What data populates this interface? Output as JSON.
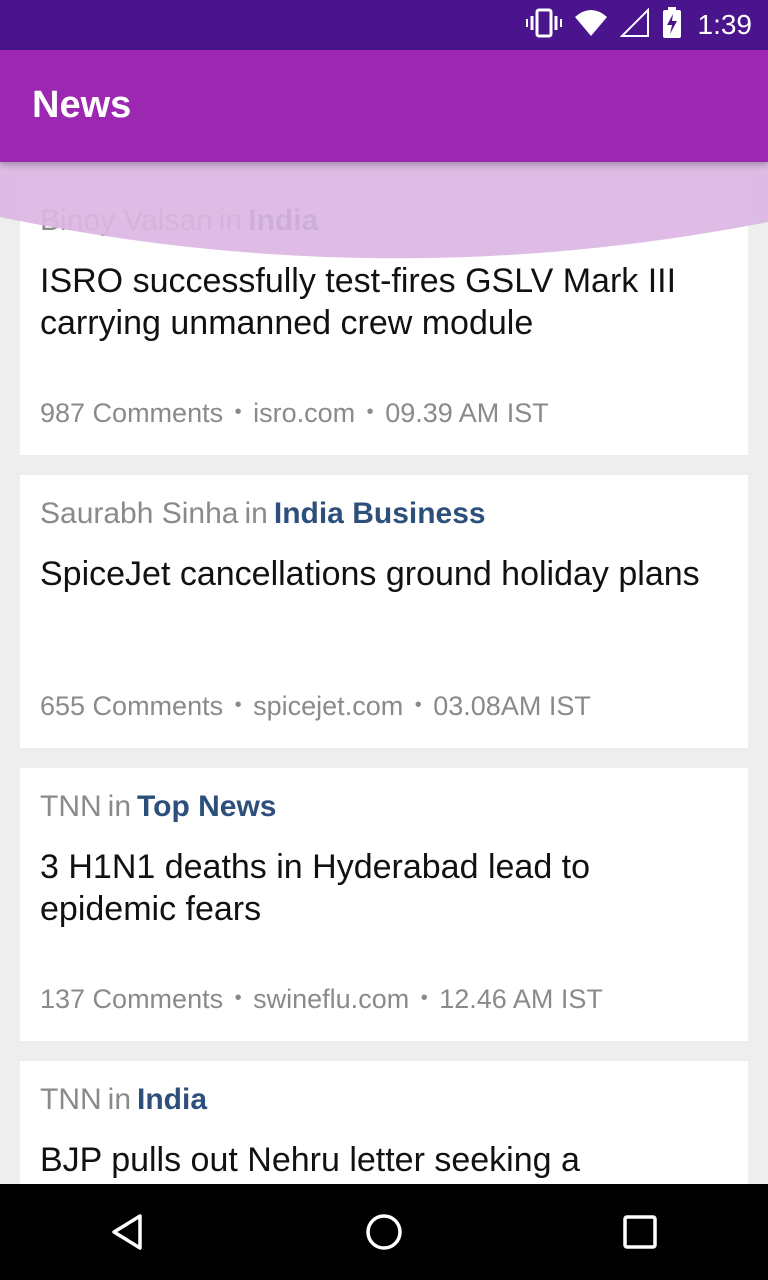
{
  "status_bar": {
    "time": "1:39",
    "icons": [
      "vibrate-icon",
      "wifi-icon",
      "signal-icon",
      "battery-charging-icon"
    ]
  },
  "app_bar": {
    "title": "News"
  },
  "colors": {
    "status_bar": "#4a148c",
    "app_bar": "#9c27b0",
    "section_link": "#2c4f7c",
    "ripple": "#dbb6e3"
  },
  "articles": [
    {
      "author": "Binoy Valsan",
      "in": "in",
      "section": "India",
      "headline": "ISRO successfully test-fires GSLV Mark III carrying unmanned crew module",
      "comments": "987 Comments",
      "source": "isro.com",
      "time": "09.39 AM IST"
    },
    {
      "author": "Saurabh Sinha",
      "in": "in",
      "section": "India Business",
      "headline": "SpiceJet cancellations ground holiday plans",
      "comments": "655 Comments",
      "source": "spicejet.com",
      "time": "03.08AM IST"
    },
    {
      "author": "TNN",
      "in": "in",
      "section": "Top News",
      "headline": "3 H1N1 deaths in Hyderabad lead to epidemic fears",
      "comments": "137 Comments",
      "source": "swineflu.com",
      "time": "12.46 AM IST"
    },
    {
      "author": "TNN",
      "in": "in",
      "section": "India",
      "headline": "BJP pulls out Nehru letter seeking a",
      "comments": "",
      "source": "",
      "time": ""
    }
  ],
  "separator": "•",
  "nav_bar": {
    "buttons": [
      "back-icon",
      "home-icon",
      "recents-icon"
    ]
  }
}
